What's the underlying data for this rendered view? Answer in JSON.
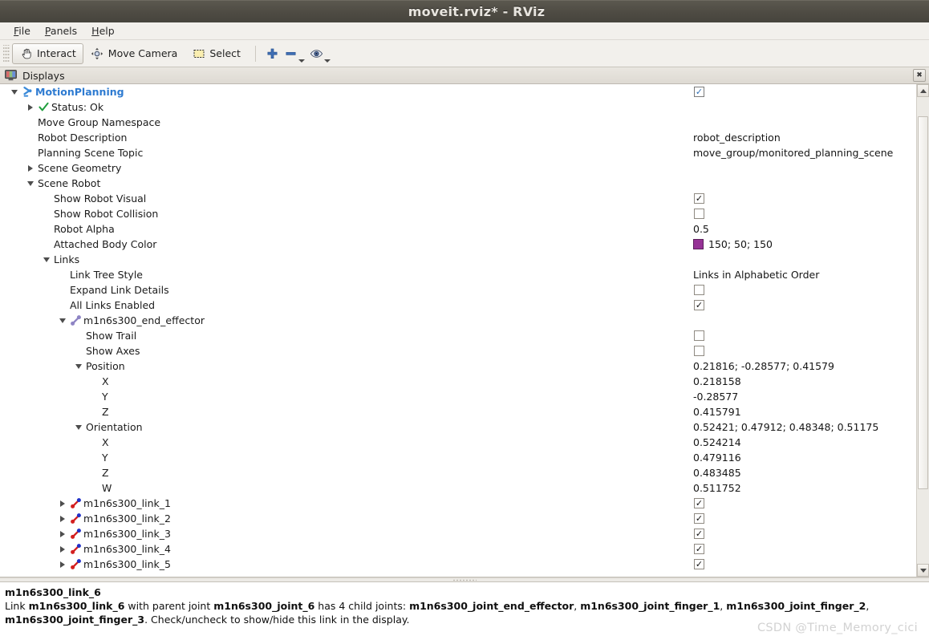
{
  "window": {
    "title": "moveit.rviz* - RViz"
  },
  "menubar": {
    "items": [
      {
        "label": "File",
        "mnemonic": "F"
      },
      {
        "label": "Panels",
        "mnemonic": "P"
      },
      {
        "label": "Help",
        "mnemonic": "H"
      }
    ]
  },
  "toolbar": {
    "interact_label": "Interact",
    "move_camera_label": "Move Camera",
    "select_label": "Select",
    "add_icon": "plus-icon",
    "remove_icon": "minus-icon",
    "focus_icon": "eye-icon"
  },
  "displays_panel": {
    "title": "Displays",
    "icon": "display-monitor-icon",
    "close_label": "✖"
  },
  "tree": {
    "rows": [
      {
        "indent": 0,
        "twisty": "down",
        "icon": "motionplanning-icon",
        "label": "MotionPlanning",
        "style": "bold-blue",
        "value_type": "checkbox",
        "value": "checked-blue"
      },
      {
        "indent": 1,
        "twisty": "right",
        "icon": "status-ok-icon",
        "label": "Status: Ok",
        "value_type": "none",
        "value": ""
      },
      {
        "indent": 1,
        "twisty": "none",
        "icon": "none",
        "label": "Move Group Namespace",
        "value_type": "none",
        "value": ""
      },
      {
        "indent": 1,
        "twisty": "none",
        "icon": "none",
        "label": "Robot Description",
        "value_type": "text",
        "value": "robot_description"
      },
      {
        "indent": 1,
        "twisty": "none",
        "icon": "none",
        "label": "Planning Scene Topic",
        "value_type": "text",
        "value": "move_group/monitored_planning_scene"
      },
      {
        "indent": 1,
        "twisty": "right",
        "icon": "none",
        "label": "Scene Geometry",
        "value_type": "none",
        "value": ""
      },
      {
        "indent": 1,
        "twisty": "down",
        "icon": "none",
        "label": "Scene Robot",
        "value_type": "none",
        "value": ""
      },
      {
        "indent": 2,
        "twisty": "none",
        "icon": "none",
        "label": "Show Robot Visual",
        "value_type": "checkbox",
        "value": "checked"
      },
      {
        "indent": 2,
        "twisty": "none",
        "icon": "none",
        "label": "Show Robot Collision",
        "value_type": "checkbox",
        "value": "unchecked"
      },
      {
        "indent": 2,
        "twisty": "none",
        "icon": "none",
        "label": "Robot Alpha",
        "value_type": "text",
        "value": "0.5"
      },
      {
        "indent": 2,
        "twisty": "none",
        "icon": "none",
        "label": "Attached Body Color",
        "value_type": "color",
        "value": "150; 50; 150",
        "color": "#963296"
      },
      {
        "indent": 2,
        "twisty": "down",
        "icon": "none",
        "label": "Links",
        "value_type": "none",
        "value": ""
      },
      {
        "indent": 3,
        "twisty": "none",
        "icon": "none",
        "label": "Link Tree Style",
        "value_type": "text",
        "value": "Links in Alphabetic Order"
      },
      {
        "indent": 3,
        "twisty": "none",
        "icon": "none",
        "label": "Expand Link Details",
        "value_type": "checkbox",
        "value": "unchecked"
      },
      {
        "indent": 3,
        "twisty": "none",
        "icon": "none",
        "label": "All Links Enabled",
        "value_type": "checkbox",
        "value": "checked"
      },
      {
        "indent": 3,
        "twisty": "down",
        "icon": "link-purple-icon",
        "label": "m1n6s300_end_effector",
        "value_type": "none",
        "value": ""
      },
      {
        "indent": 4,
        "twisty": "none",
        "icon": "none",
        "label": "Show Trail",
        "value_type": "checkbox",
        "value": "unchecked"
      },
      {
        "indent": 4,
        "twisty": "none",
        "icon": "none",
        "label": "Show Axes",
        "value_type": "checkbox",
        "value": "unchecked"
      },
      {
        "indent": 4,
        "twisty": "down",
        "icon": "none",
        "label": "Position",
        "value_type": "text",
        "value": "0.21816; -0.28577; 0.41579"
      },
      {
        "indent": 5,
        "twisty": "none",
        "icon": "none",
        "label": "X",
        "value_type": "text",
        "value": "0.218158"
      },
      {
        "indent": 5,
        "twisty": "none",
        "icon": "none",
        "label": "Y",
        "value_type": "text",
        "value": "-0.28577"
      },
      {
        "indent": 5,
        "twisty": "none",
        "icon": "none",
        "label": "Z",
        "value_type": "text",
        "value": "0.415791"
      },
      {
        "indent": 4,
        "twisty": "down",
        "icon": "none",
        "label": "Orientation",
        "value_type": "text",
        "value": "0.52421; 0.47912; 0.48348; 0.51175"
      },
      {
        "indent": 5,
        "twisty": "none",
        "icon": "none",
        "label": "X",
        "value_type": "text",
        "value": "0.524214"
      },
      {
        "indent": 5,
        "twisty": "none",
        "icon": "none",
        "label": "Y",
        "value_type": "text",
        "value": "0.479116"
      },
      {
        "indent": 5,
        "twisty": "none",
        "icon": "none",
        "label": "Z",
        "value_type": "text",
        "value": "0.483485"
      },
      {
        "indent": 5,
        "twisty": "none",
        "icon": "none",
        "label": "W",
        "value_type": "text",
        "value": "0.511752"
      },
      {
        "indent": 3,
        "twisty": "right",
        "icon": "link-icon",
        "label": "m1n6s300_link_1",
        "value_type": "checkbox",
        "value": "checked"
      },
      {
        "indent": 3,
        "twisty": "right",
        "icon": "link-icon",
        "label": "m1n6s300_link_2",
        "value_type": "checkbox",
        "value": "checked"
      },
      {
        "indent": 3,
        "twisty": "right",
        "icon": "link-icon",
        "label": "m1n6s300_link_3",
        "value_type": "checkbox",
        "value": "checked"
      },
      {
        "indent": 3,
        "twisty": "right",
        "icon": "link-icon",
        "label": "m1n6s300_link_4",
        "value_type": "checkbox",
        "value": "checked"
      },
      {
        "indent": 3,
        "twisty": "right",
        "icon": "link-icon",
        "label": "m1n6s300_link_5",
        "value_type": "checkbox",
        "value": "checked"
      }
    ]
  },
  "status_panel": {
    "title": "m1n6s300_link_6",
    "line_parts": [
      {
        "text": "Link ",
        "bold": false
      },
      {
        "text": "m1n6s300_link_6",
        "bold": true
      },
      {
        "text": " with parent joint ",
        "bold": false
      },
      {
        "text": "m1n6s300_joint_6",
        "bold": true
      },
      {
        "text": " has 4 child joints: ",
        "bold": false
      },
      {
        "text": "m1n6s300_joint_end_effector",
        "bold": true
      },
      {
        "text": ", ",
        "bold": false
      },
      {
        "text": "m1n6s300_joint_finger_1",
        "bold": true
      },
      {
        "text": ", ",
        "bold": false
      },
      {
        "text": "m1n6s300_joint_finger_2",
        "bold": true
      },
      {
        "text": ", ",
        "bold": false
      },
      {
        "text": "m1n6s300_joint_finger_3",
        "bold": true
      },
      {
        "text": ". Check/uncheck to show/hide this link in the display.",
        "bold": false
      }
    ]
  },
  "watermark": {
    "text": "CSDN @Time_Memory_cici"
  }
}
